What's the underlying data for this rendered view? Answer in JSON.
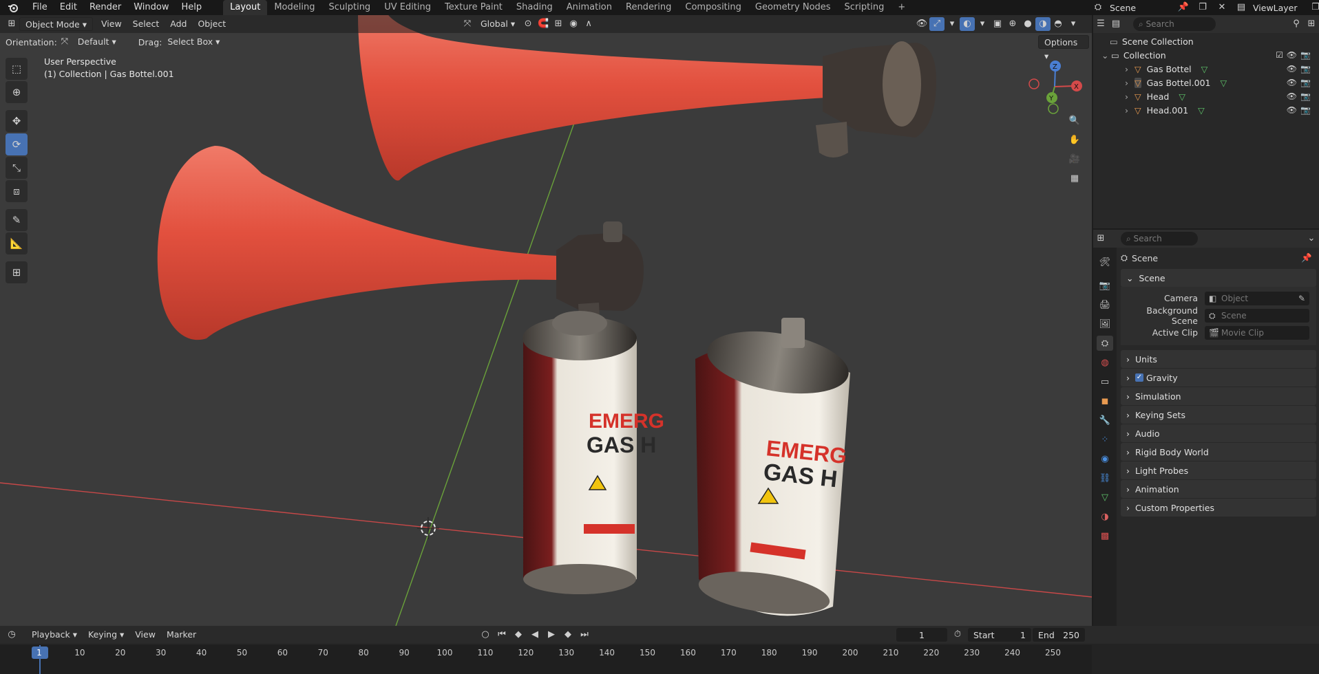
{
  "app": {
    "name": "Blender"
  },
  "menu": [
    "File",
    "Edit",
    "Render",
    "Window",
    "Help"
  ],
  "workspaces": [
    "Layout",
    "Modeling",
    "Sculpting",
    "UV Editing",
    "Texture Paint",
    "Shading",
    "Animation",
    "Rendering",
    "Compositing",
    "Geometry Nodes",
    "Scripting"
  ],
  "active_workspace": "Layout",
  "topright": {
    "scene": "Scene",
    "view_layer": "ViewLayer"
  },
  "viewport": {
    "mode": "Object Mode",
    "menus": [
      "View",
      "Select",
      "Add",
      "Object"
    ],
    "transform_orientation": "Global",
    "orientation_label": "Orientation:",
    "orientation_value": "Default",
    "drag_label": "Drag:",
    "drag_value": "Select Box",
    "options": "Options",
    "perspective": "User Perspective",
    "collection_info": "(1) Collection | Gas Bottel.001",
    "gizmo": {
      "z": "Z",
      "x": "X",
      "y": "Y"
    },
    "can_text": {
      "line1": "EMERG",
      "line2": "GAS H",
      "warning": "WARNING"
    }
  },
  "outliner": {
    "search_placeholder": "Search",
    "root": "Scene Collection",
    "collection": "Collection",
    "items": [
      {
        "name": "Gas Bottel"
      },
      {
        "name": "Gas Bottel.001"
      },
      {
        "name": "Head"
      },
      {
        "name": "Head.001"
      }
    ]
  },
  "properties": {
    "search_placeholder": "Search",
    "context": "Scene",
    "panel_title": "Scene",
    "fields": [
      {
        "label": "Camera",
        "placeholder": "Object"
      },
      {
        "label": "Background Scene",
        "placeholder": "Scene"
      },
      {
        "label": "Active Clip",
        "placeholder": "Movie Clip"
      }
    ],
    "sections": [
      "Units",
      "Gravity",
      "Simulation",
      "Keying Sets",
      "Audio",
      "Rigid Body World",
      "Light Probes",
      "Animation",
      "Custom Properties"
    ],
    "gravity_checked": true
  },
  "timeline": {
    "menus": [
      "Playback",
      "Keying",
      "View",
      "Marker"
    ],
    "current_frame": "1",
    "start_label": "Start",
    "start": "1",
    "end_label": "End",
    "end": "250",
    "ticks": [
      "1",
      "10",
      "20",
      "30",
      "40",
      "50",
      "60",
      "70",
      "80",
      "90",
      "100",
      "110",
      "120",
      "130",
      "140",
      "150",
      "160",
      "170",
      "180",
      "190",
      "200",
      "210",
      "220",
      "230",
      "240",
      "250"
    ]
  },
  "colors": {
    "accent": "#4772b3",
    "horn": "#e2503e",
    "x_axis": "#c84848",
    "y_axis": "#6aa23a"
  }
}
